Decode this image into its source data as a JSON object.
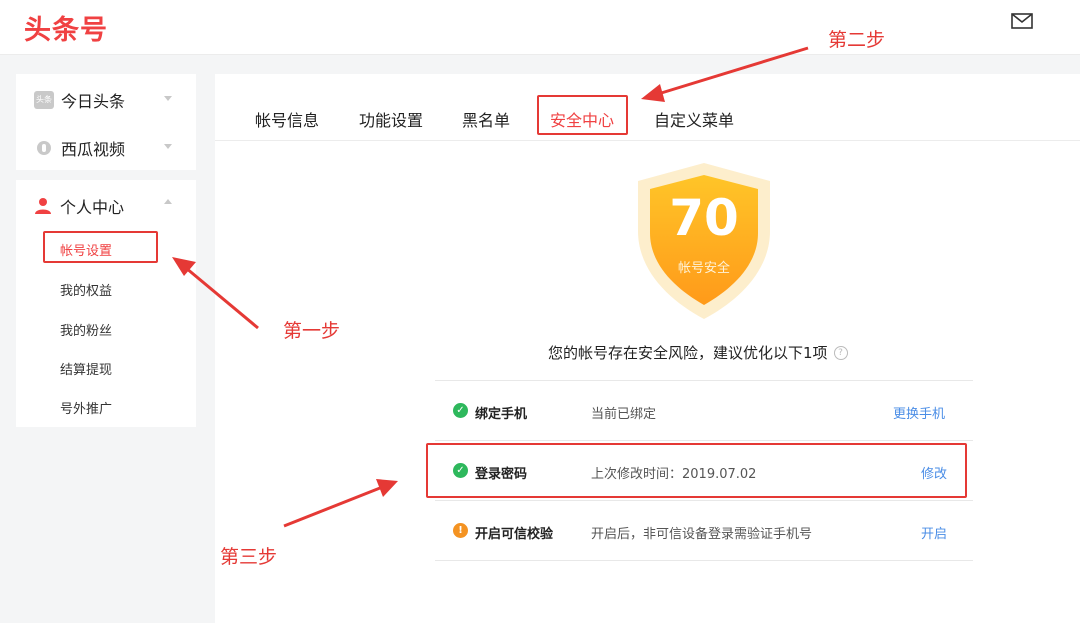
{
  "app": {
    "logo": "头条号"
  },
  "header": {
    "mail_icon": "mail-icon"
  },
  "sidebar": {
    "groups": [
      {
        "label": "今日头条",
        "icon": "toutiao-icon"
      },
      {
        "label": "西瓜视频",
        "icon": "play-circle-icon"
      }
    ],
    "personal": {
      "label": "个人中心",
      "icon": "user-icon",
      "items": [
        {
          "label": "帐号设置"
        },
        {
          "label": "我的权益"
        },
        {
          "label": "我的粉丝"
        },
        {
          "label": "结算提现"
        },
        {
          "label": "号外推广"
        }
      ]
    }
  },
  "tabs": [
    {
      "label": "帐号信息"
    },
    {
      "label": "功能设置"
    },
    {
      "label": "黑名单"
    },
    {
      "label": "安全中心"
    },
    {
      "label": "自定义菜单"
    }
  ],
  "security": {
    "score": "70",
    "score_label": "帐号安全",
    "warning": "您的帐号存在安全风险，建议优化以下1项",
    "rows": [
      {
        "name": "绑定手机",
        "desc": "当前已绑定",
        "action": "更换手机",
        "status": "ok"
      },
      {
        "name": "登录密码",
        "desc": "上次修改时间：2019.07.02",
        "action": "修改",
        "status": "ok"
      },
      {
        "name": "开启可信校验",
        "desc": "开启后，非可信设备登录需验证手机号",
        "action": "开启",
        "status": "alert"
      }
    ]
  },
  "annotations": {
    "step1": "第一步",
    "step2": "第二步",
    "step3": "第三步"
  },
  "colors": {
    "brand": "#f04142",
    "annotation": "#e53935",
    "link": "#4a8de6",
    "ok": "#2eb85c",
    "warn": "#f49322",
    "shield": "#ffb21d"
  }
}
